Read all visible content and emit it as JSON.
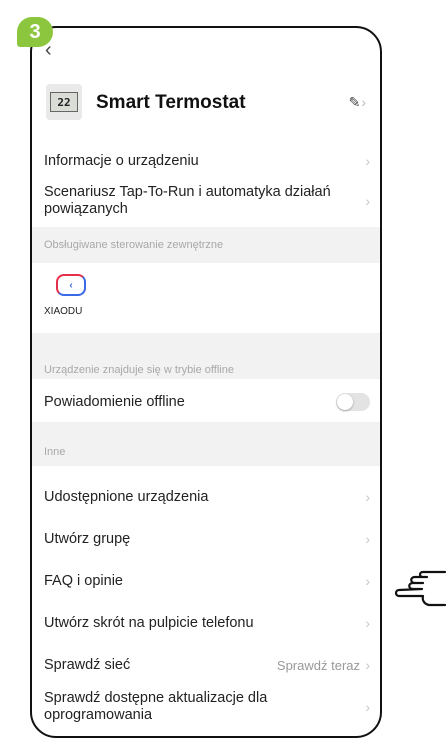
{
  "step": "3",
  "icons": {
    "back": "chevron-left-icon",
    "edit": "pencil-icon",
    "chevron": "chevron-right-icon",
    "device": "thermostat-thumbnail-icon",
    "xiaodu": "xiaodu-logo-icon",
    "pointer": "pointing-hand-icon"
  },
  "device": {
    "name": "Smart Termostat",
    "display": "22"
  },
  "rows_top": [
    {
      "label": "Informacje o urządzeniu"
    },
    {
      "label": "Scenariusz Tap-To-Run i automatyka działań powiązanych"
    }
  ],
  "sections": {
    "external_control": "Obsługiwane sterowanie zewnętrzne",
    "offline": "Urządzenie znajduje się w trybie offline",
    "other": "Inne"
  },
  "xiaodu": {
    "label": "XIAODU"
  },
  "offline_notification": {
    "label": "Powiadomienie offline",
    "enabled": false
  },
  "rows_other": [
    {
      "label": "Udostępnione urządzenia"
    },
    {
      "label": "Utwórz grupę"
    },
    {
      "label": "FAQ i opinie"
    },
    {
      "label": "Utwórz skrót na pulpicie telefonu"
    },
    {
      "label": "Sprawdź sieć",
      "value": "Sprawdź teraz"
    },
    {
      "label": "Sprawdź dostępne aktualizacje dla oprogramowania"
    }
  ],
  "colors": {
    "badge": "#8cc63f",
    "section_bg": "#f2f2f2",
    "xiaodu_red": "#e6304b",
    "xiaodu_blue": "#3b6ae6"
  }
}
